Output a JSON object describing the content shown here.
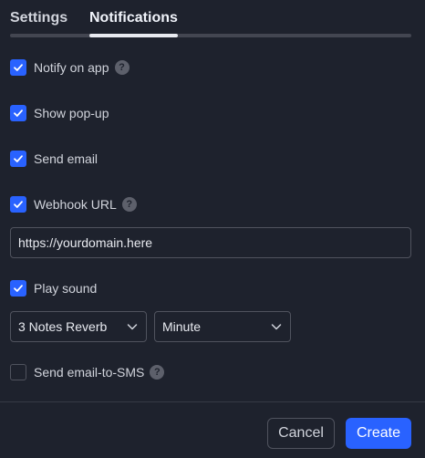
{
  "tabs": {
    "settings": "Settings",
    "notifications": "Notifications",
    "active": "notifications"
  },
  "options": {
    "notify_on_app": {
      "label": "Notify on app",
      "checked": true,
      "help": "?"
    },
    "show_popup": {
      "label": "Show pop-up",
      "checked": true
    },
    "send_email": {
      "label": "Send email",
      "checked": true
    },
    "webhook_url": {
      "label": "Webhook URL",
      "checked": true,
      "help": "?"
    },
    "play_sound": {
      "label": "Play sound",
      "checked": true
    },
    "send_email_to_sms": {
      "label": "Send email-to-SMS",
      "checked": false,
      "help": "?"
    }
  },
  "webhook": {
    "value": "https://yourdomain.here"
  },
  "sound": {
    "selected": "3 Notes Reverb",
    "duration_unit": "Minute"
  },
  "footer": {
    "cancel_label": "Cancel",
    "create_label": "Create"
  },
  "colors": {
    "background": "#1e222d",
    "accent": "#2962ff",
    "text": "#d1d4dc",
    "border": "#50535e"
  },
  "icons": {
    "check": "check-icon",
    "help": "question-circle-icon",
    "dropdown": "chevron-down-icon"
  }
}
